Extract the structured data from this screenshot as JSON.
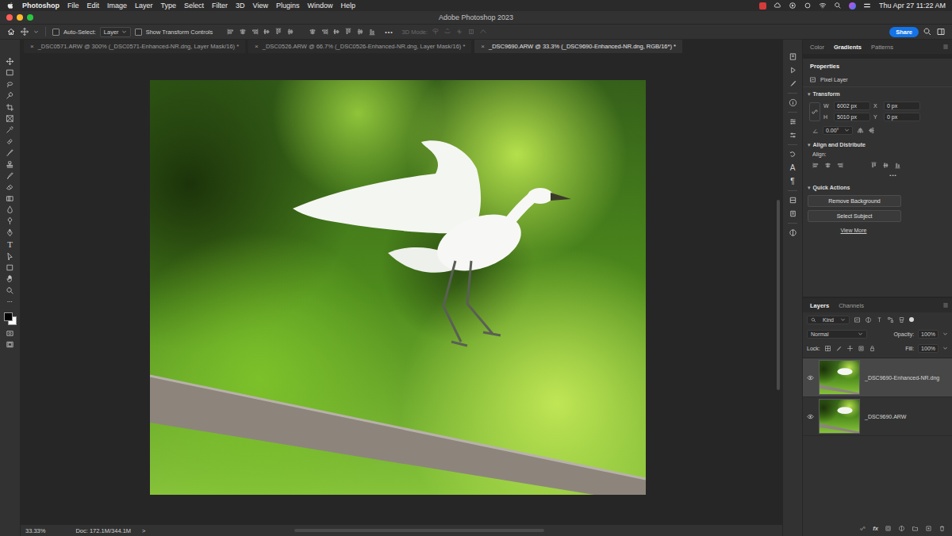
{
  "menubar": {
    "app": "Photoshop",
    "items": [
      "File",
      "Edit",
      "Image",
      "Layer",
      "Type",
      "Select",
      "Filter",
      "3D",
      "View",
      "Plugins",
      "Window",
      "Help"
    ],
    "clock": "Thu Apr 27  11:22 AM"
  },
  "window": {
    "title": "Adobe Photoshop 2023",
    "controls": [
      {
        "color": "#ff5f57"
      },
      {
        "color": "#febc2e"
      },
      {
        "color": "#28c840"
      }
    ]
  },
  "options_bar": {
    "auto_select": {
      "label": "Auto-Select:",
      "checked": false
    },
    "target": "Layer",
    "show_transform": {
      "label": "Show Transform Controls",
      "checked": false
    },
    "more": "•••",
    "mode": {
      "label": "3D Mode:",
      "disabled": true
    },
    "share": "Share"
  },
  "doc_tabs": {
    "close": "×",
    "tabs": [
      {
        "label": "_DSC0571.ARW @ 300% (_DSC0571-Enhanced-NR.dng, Layer Mask/16) *",
        "selected": false
      },
      {
        "label": "_DSC0526.ARW @ 66.7% (_DSC0526-Enhanced-NR.dng, Layer Mask/16) *",
        "selected": false
      },
      {
        "label": "_DSC9690.ARW @ 33.3% (_DSC9690-Enhanced-NR.dng, RGB/16*) *",
        "selected": true
      }
    ]
  },
  "toolbar": {
    "type_glyph": "T",
    "foreground": "#000000",
    "background": "#ffffff"
  },
  "panel_strip": {
    "glyphs": [
      "A",
      "¶"
    ]
  },
  "status_bar": {
    "zoom": "33.33%",
    "doc": "Doc: 172.1M/344.1M",
    "arrow": ">"
  },
  "top_panel": {
    "tabs": [
      {
        "label": "Color",
        "selected": false
      },
      {
        "label": "Gradients",
        "selected": true
      },
      {
        "label": "Patterns",
        "selected": false
      }
    ]
  },
  "properties": {
    "tab": "Properties",
    "kind": "Pixel Layer",
    "transform": {
      "title": "Transform",
      "fields": [
        {
          "label": "W",
          "value": "6002 px"
        },
        {
          "label": "X",
          "value": "0 px"
        },
        {
          "label": "H",
          "value": "5010 px"
        },
        {
          "label": "Y",
          "value": "0 px"
        }
      ],
      "angle": "0.00°"
    },
    "align": {
      "title": "Align and Distribute",
      "label": "Align:",
      "more": "•••"
    },
    "quick_actions": {
      "title": "Quick Actions",
      "buttons": [
        "Remove Background",
        "Select Subject"
      ],
      "link": "View More"
    }
  },
  "layers_panel": {
    "tabs": [
      {
        "label": "Layers",
        "selected": true
      },
      {
        "label": "Channels",
        "selected": false
      }
    ],
    "filter": "Kind",
    "blend": "Normal",
    "opacity_label": "Opacity:",
    "opacity": "100%",
    "lock_label": "Lock:",
    "fill_label": "Fill:",
    "fill": "100%",
    "fx": "fx",
    "layers": [
      {
        "name": "_DSC9690-Enhanced-NR.dng",
        "visible": true,
        "selected": true
      },
      {
        "name": "_DSC9690.ARW",
        "visible": true,
        "selected": false
      }
    ]
  }
}
